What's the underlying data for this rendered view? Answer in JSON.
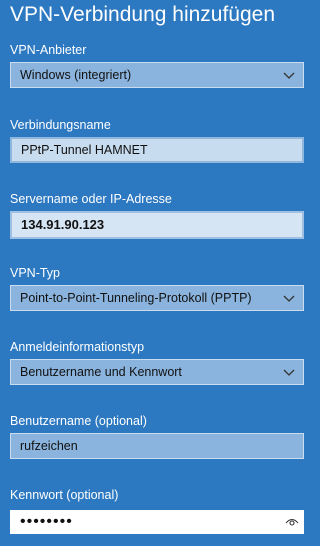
{
  "page": {
    "title": "VPN-Verbindung hinzufügen"
  },
  "form": {
    "provider": {
      "label": "VPN-Anbieter",
      "value": "Windows (integriert)"
    },
    "connection_name": {
      "label": "Verbindungsname",
      "value": "PPtP-Tunnel HAMNET"
    },
    "server": {
      "label": "Servername oder IP-Adresse",
      "value": "134.91.90.123"
    },
    "vpn_type": {
      "label": "VPN-Typ",
      "value": "Point-to-Point-Tunneling-Protokoll (PPTP)"
    },
    "signin_info_type": {
      "label": "Anmeldeinformationstyp",
      "value": "Benutzername und Kennwort"
    },
    "username": {
      "label": "Benutzername (optional)",
      "value": "rufzeichen"
    },
    "password": {
      "label": "Kennwort (optional)",
      "value": "••••••••"
    }
  },
  "colors": {
    "background": "#2c78c1",
    "dropdown": "#8ab4dd",
    "input_light": "#c8dcf0",
    "text_dark": "#111111"
  },
  "icons": {
    "dropdown": "chevron-down-icon",
    "reveal_password": "eye-icon"
  }
}
